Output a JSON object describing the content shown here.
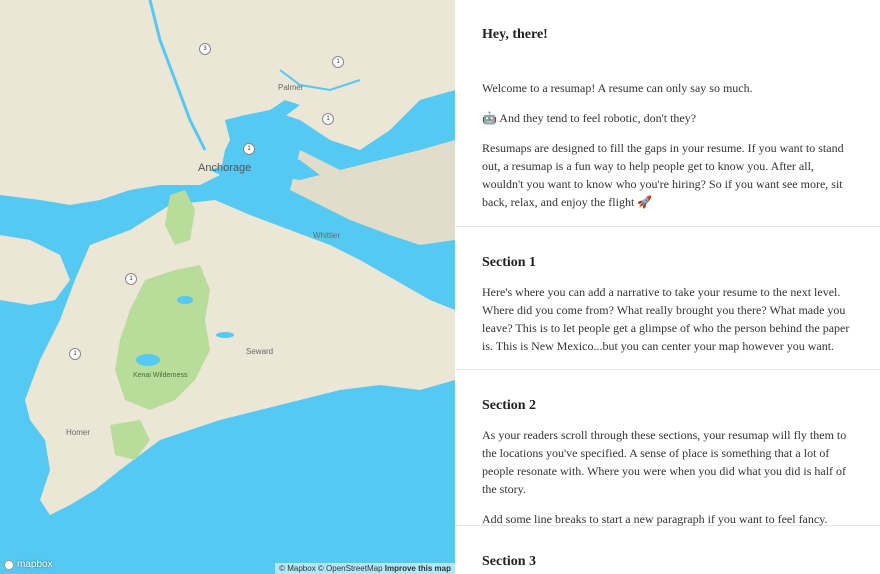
{
  "map": {
    "labels": {
      "anchorage": "Anchorage",
      "palmer": "Palmer",
      "whittier": "Whittier",
      "seward": "Seward",
      "homer": "Homer",
      "kenai_wilderness": "Kenai Wilderness"
    },
    "shields": [
      "3",
      "1",
      "1",
      "1",
      "1",
      "1"
    ],
    "logo_text": "mapbox",
    "attribution": {
      "mapbox": "© Mapbox",
      "osm": "© OpenStreetMap",
      "improve": "Improve this map"
    },
    "colors": {
      "water": "#55c9f2",
      "land": "#ece6d6",
      "park": "#b8dc9a"
    }
  },
  "story": {
    "intro": {
      "title": "Hey, there!",
      "p1": "Welcome to a resumap! A resume can only say so much.",
      "p2_icon": "🤖",
      "p2": " And they tend to feel robotic, don't they?",
      "p3": "Resumaps are designed to fill the gaps in your resume. If you want to stand out, a resumap is a fun way to help people get to know you. After all, wouldn't you want to know who you're hiring? So if you want see more, sit back, relax, and enjoy the flight ",
      "p3_icon": "🚀"
    },
    "section1": {
      "title": "Section 1",
      "body": "Here's where you can add a narrative to take your resume to the next level. Where did you come from? What really brought you there? What made you leave? This is to let people get a glimpse of who the person behind the paper is. This is New Mexico...but you can center your map however you want."
    },
    "section2": {
      "title": "Section 2",
      "p1": "As your readers scroll through these sections, your resumap will fly them to the locations you've specified. A sense of place is something that a lot of people resonate with. Where you were when you did what you did is half of the story.",
      "p2": "Add some line breaks to start a new paragraph if you want to feel fancy."
    },
    "section3": {
      "title": "Section 3"
    }
  }
}
